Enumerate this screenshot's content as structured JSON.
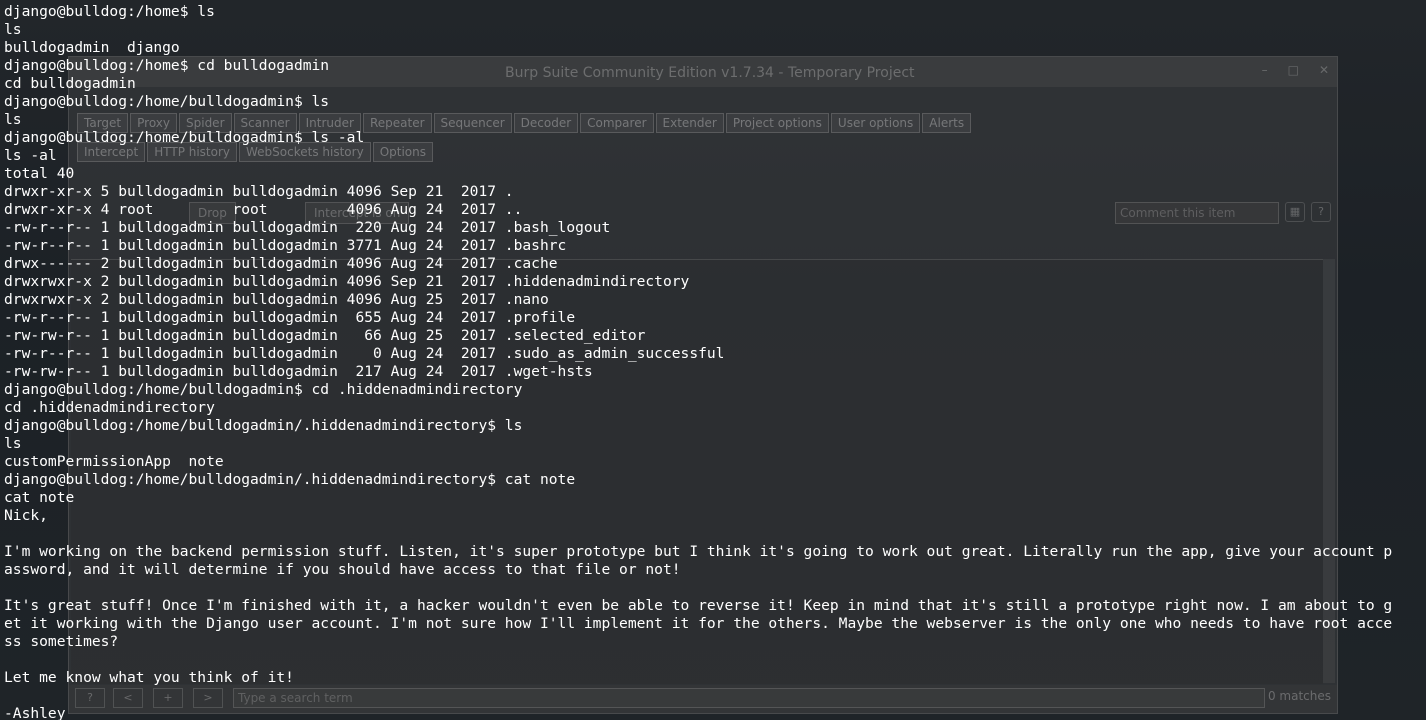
{
  "burp": {
    "title": "Burp Suite Community Edition v1.7.34 - Temporary Project",
    "main_tabs": [
      "Target",
      "Proxy",
      "Spider",
      "Scanner",
      "Intruder",
      "Repeater",
      "Sequencer",
      "Decoder",
      "Comparer",
      "Extender",
      "Project options",
      "User options",
      "Alerts"
    ],
    "sub_tabs": [
      "Intercept",
      "HTTP history",
      "WebSockets history",
      "Options"
    ],
    "drop_label": "Drop",
    "intercept_label": "Intercept is on",
    "comment_placeholder": "Comment this item",
    "search_placeholder": "Type a search term",
    "matches": "0 matches"
  },
  "terminal": {
    "lines": [
      "django@bulldog:/home$ ls",
      "ls",
      "bulldogadmin  django",
      "django@bulldog:/home$ cd bulldogadmin",
      "cd bulldogadmin",
      "django@bulldog:/home/bulldogadmin$ ls",
      "ls",
      "django@bulldog:/home/bulldogadmin$ ls -al",
      "ls -al",
      "total 40",
      "drwxr-xr-x 5 bulldogadmin bulldogadmin 4096 Sep 21  2017 .",
      "drwxr-xr-x 4 root         root         4096 Aug 24  2017 ..",
      "-rw-r--r-- 1 bulldogadmin bulldogadmin  220 Aug 24  2017 .bash_logout",
      "-rw-r--r-- 1 bulldogadmin bulldogadmin 3771 Aug 24  2017 .bashrc",
      "drwx------ 2 bulldogadmin bulldogadmin 4096 Aug 24  2017 .cache",
      "drwxrwxr-x 2 bulldogadmin bulldogadmin 4096 Sep 21  2017 .hiddenadmindirectory",
      "drwxrwxr-x 2 bulldogadmin bulldogadmin 4096 Aug 25  2017 .nano",
      "-rw-r--r-- 1 bulldogadmin bulldogadmin  655 Aug 24  2017 .profile",
      "-rw-rw-r-- 1 bulldogadmin bulldogadmin   66 Aug 25  2017 .selected_editor",
      "-rw-r--r-- 1 bulldogadmin bulldogadmin    0 Aug 24  2017 .sudo_as_admin_successful",
      "-rw-rw-r-- 1 bulldogadmin bulldogadmin  217 Aug 24  2017 .wget-hsts",
      "django@bulldog:/home/bulldogadmin$ cd .hiddenadmindirectory",
      "cd .hiddenadmindirectory",
      "django@bulldog:/home/bulldogadmin/.hiddenadmindirectory$ ls",
      "ls",
      "customPermissionApp  note",
      "django@bulldog:/home/bulldogadmin/.hiddenadmindirectory$ cat note",
      "cat note",
      "Nick,",
      "",
      "I'm working on the backend permission stuff. Listen, it's super prototype but I think it's going to work out great. Literally run the app, give your account p",
      "assword, and it will determine if you should have access to that file or not!",
      "",
      "It's great stuff! Once I'm finished with it, a hacker wouldn't even be able to reverse it! Keep in mind that it's still a prototype right now. I am about to g",
      "et it working with the Django user account. I'm not sure how I'll implement it for the others. Maybe the webserver is the only one who needs to have root acce",
      "ss sometimes?",
      "",
      "Let me know what you think of it!",
      "",
      "-Ashley"
    ]
  }
}
